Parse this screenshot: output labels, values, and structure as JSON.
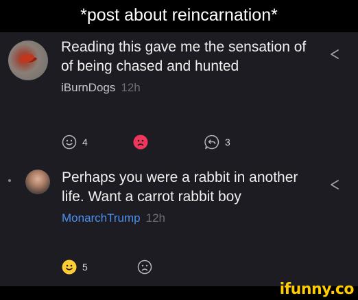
{
  "caption": "*post about reincarnation*",
  "comments": [
    {
      "text": "Reading this gave me the sensation of of being chased and hunted",
      "author": "iBurnDogs",
      "time": "12h",
      "likes": "4",
      "replies": "3",
      "reaction": "dislike"
    },
    {
      "text": "Perhaps you were a rabbit in another life. Want a carrot rabbit boy",
      "author": "MonarchTrump",
      "time": "12h",
      "likes": "5",
      "reaction": "like"
    }
  ],
  "watermark": "ifunny.co",
  "colors": {
    "background": "#1c1c22",
    "like_active": "#ffcc33",
    "dislike_active": "#f0365a",
    "link_author": "#4a8ff0"
  }
}
